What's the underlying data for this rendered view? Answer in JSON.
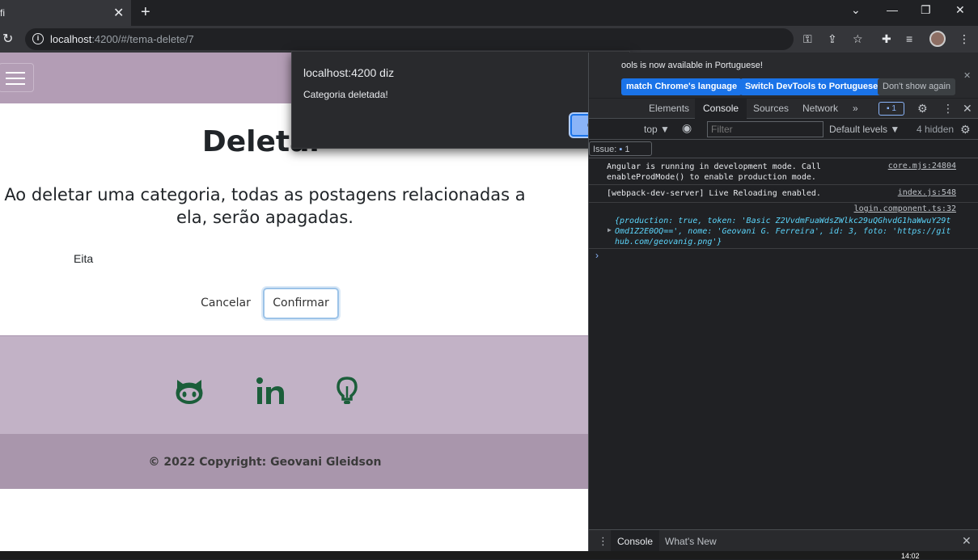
{
  "browser": {
    "tab_title": "fi",
    "tab_close": "✕",
    "new_tab": "+",
    "url_host": "localhost",
    "url_rest": ":4200/#/tema-delete/7"
  },
  "page": {
    "title": "Deletar",
    "warning_line1": "Ao deletar uma categoria, todas as postagens relacionadas a",
    "warning_line2": "ela, serão apagadas.",
    "theme_description": "Eita",
    "cancel_label": "Cancelar",
    "confirm_label": "Confirmar",
    "copyright": "© 2022 Copyright: Geovani Gleidson"
  },
  "dialog": {
    "title": "localhost:4200 diz",
    "message": "Categoria deletada!",
    "ok_label": "OK"
  },
  "devtools": {
    "infobar_text": "ools is now available in Portuguese!",
    "match_language": "match Chrome's language",
    "switch_language": "Switch DevTools to Portuguese",
    "dont_show": "Don't show again",
    "tabs": [
      "Elements",
      "Console",
      "Sources",
      "Network"
    ],
    "more_tabs": "»",
    "issues_badge": "1",
    "context": "top ▼",
    "filter_placeholder": "Filter",
    "levels": "Default levels ▼",
    "hidden": "4 hidden",
    "issues_label": "Issue:",
    "issues_count": "1",
    "log1_l1": "Angular is running in development mode. Call",
    "log1_l2": "enableProdMode() to enable production mode.",
    "log1_src": "core.mjs:24804",
    "log2": "[webpack-dev-server] Live Reloading enabled.",
    "log2_src": "index.js:548",
    "log3_src": "login.component.ts:32",
    "log3_l1": "{production: true, token: 'Basic Z2VvdmFuaWdsZWlkc29uQGhvdG1haWwuY29t",
    "log3_l2": "Omd1Z2E0OQ==', nome: 'Geovani G. Ferreira', id: 3, foto: 'https://git",
    "log3_l3": "hub.com/geovanig.png'}",
    "drawer_tabs": [
      "Console",
      "What's New"
    ]
  },
  "taskbar": {
    "clock": "14:02"
  },
  "colors": {
    "navbar": "#b39db5",
    "footer_top": "#c2b2c6",
    "footer_bottom": "#a996ac",
    "icon_green": "#1b5e3a",
    "devtools_bg": "#202124"
  }
}
